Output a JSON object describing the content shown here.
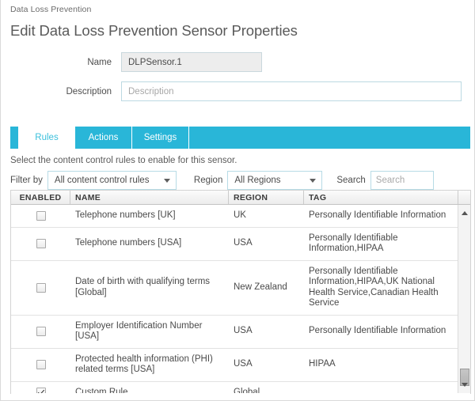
{
  "breadcrumb": "Data Loss Prevention",
  "page_title": "Edit Data Loss Prevention Sensor Properties",
  "form": {
    "name_label": "Name",
    "name_value": "DLPSensor.1",
    "description_label": "Description",
    "description_value": "",
    "description_placeholder": "Description"
  },
  "tabs": [
    {
      "label": "Rules",
      "active": true
    },
    {
      "label": "Actions",
      "active": false
    },
    {
      "label": "Settings",
      "active": false
    }
  ],
  "helper_text": "Select the content control rules to enable for this sensor.",
  "filters": {
    "filter_by_label": "Filter by",
    "filter_by_value": "All content control rules",
    "region_label": "Region",
    "region_value": "All Regions",
    "search_label": "Search",
    "search_value": "",
    "search_placeholder": "Search"
  },
  "table": {
    "columns": [
      "ENABLED",
      "NAME",
      "REGION",
      "TAG"
    ],
    "rows": [
      {
        "enabled": false,
        "name": "Telephone numbers [UK]",
        "region": "UK",
        "tag": "Personally Identifiable Information"
      },
      {
        "enabled": false,
        "name": "Telephone numbers [USA]",
        "region": "USA",
        "tag": "Personally Identifiable Information,HIPAA"
      },
      {
        "enabled": false,
        "name": "Date of birth with qualifying terms [Global]",
        "region": "New Zealand",
        "tag": "Personally Identifiable Information,HIPAA,UK National Health Service,Canadian Health Service"
      },
      {
        "enabled": false,
        "name": "Employer Identification Number [USA]",
        "region": "USA",
        "tag": "Personally Identifiable Information"
      },
      {
        "enabled": false,
        "name": "Protected health information (PHI) related terms [USA]",
        "region": "USA",
        "tag": "HIPAA"
      },
      {
        "enabled": true,
        "name": "Custom Rule",
        "region": "Global",
        "tag": ""
      }
    ]
  },
  "colors": {
    "accent_teal": "#29b6d8",
    "active_tab_text": "#3cc0dc",
    "field_border": "#b7dbe6"
  }
}
